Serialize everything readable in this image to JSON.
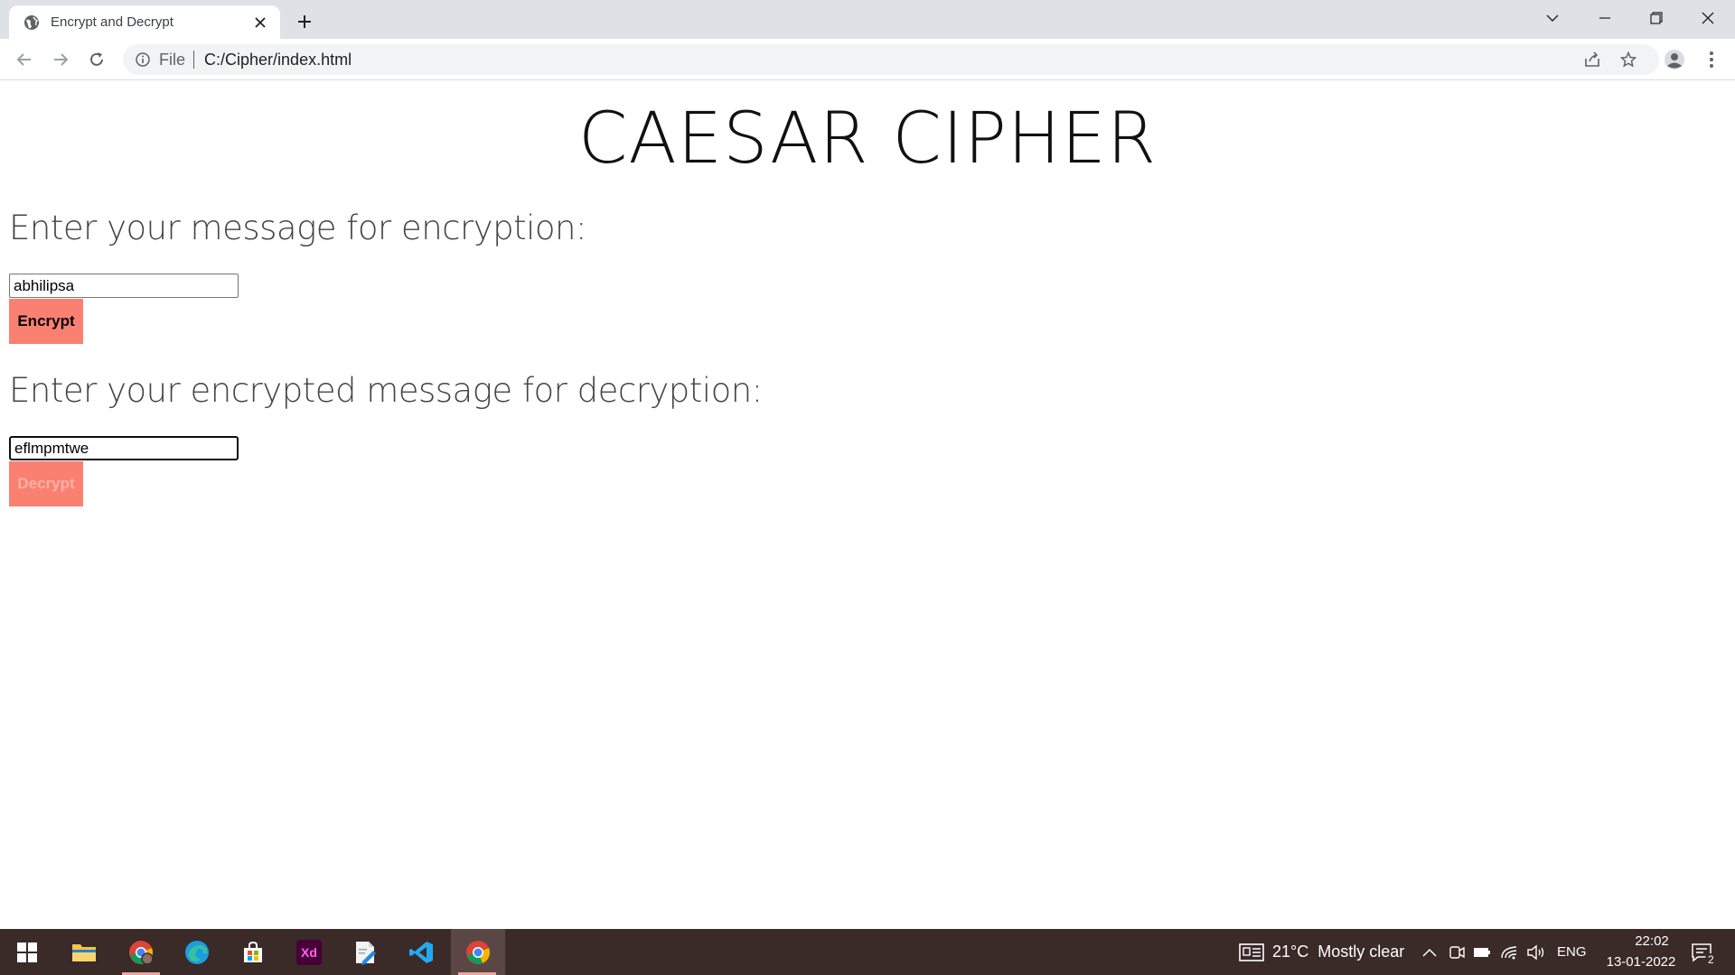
{
  "browser": {
    "tab_title": "Encrypt and Decrypt",
    "scheme_label": "File",
    "url": "C:/Cipher/index.html"
  },
  "page": {
    "title": "CAESAR CIPHER",
    "encrypt": {
      "heading": "Enter your message for encryption:",
      "input_value": "abhilipsa",
      "button_label": "Encrypt"
    },
    "decrypt": {
      "heading": "Enter your encrypted message for decryption:",
      "input_value": "eflmpmtwe",
      "button_label": "Decrypt"
    }
  },
  "taskbar": {
    "apps": [
      "windows-start",
      "file-explorer",
      "chrome-profile",
      "edge",
      "microsoft-store",
      "adobe-xd",
      "notepad",
      "vs-code",
      "chrome"
    ],
    "weather": "21°C  Mostly clear",
    "language": "ENG",
    "time": "22:02",
    "date": "13-01-2022",
    "notification_count": "2"
  },
  "colors": {
    "button_bg": "#fa8072",
    "taskbar_bg": "#3a2a28",
    "tabstrip_bg": "#dee1e6"
  }
}
